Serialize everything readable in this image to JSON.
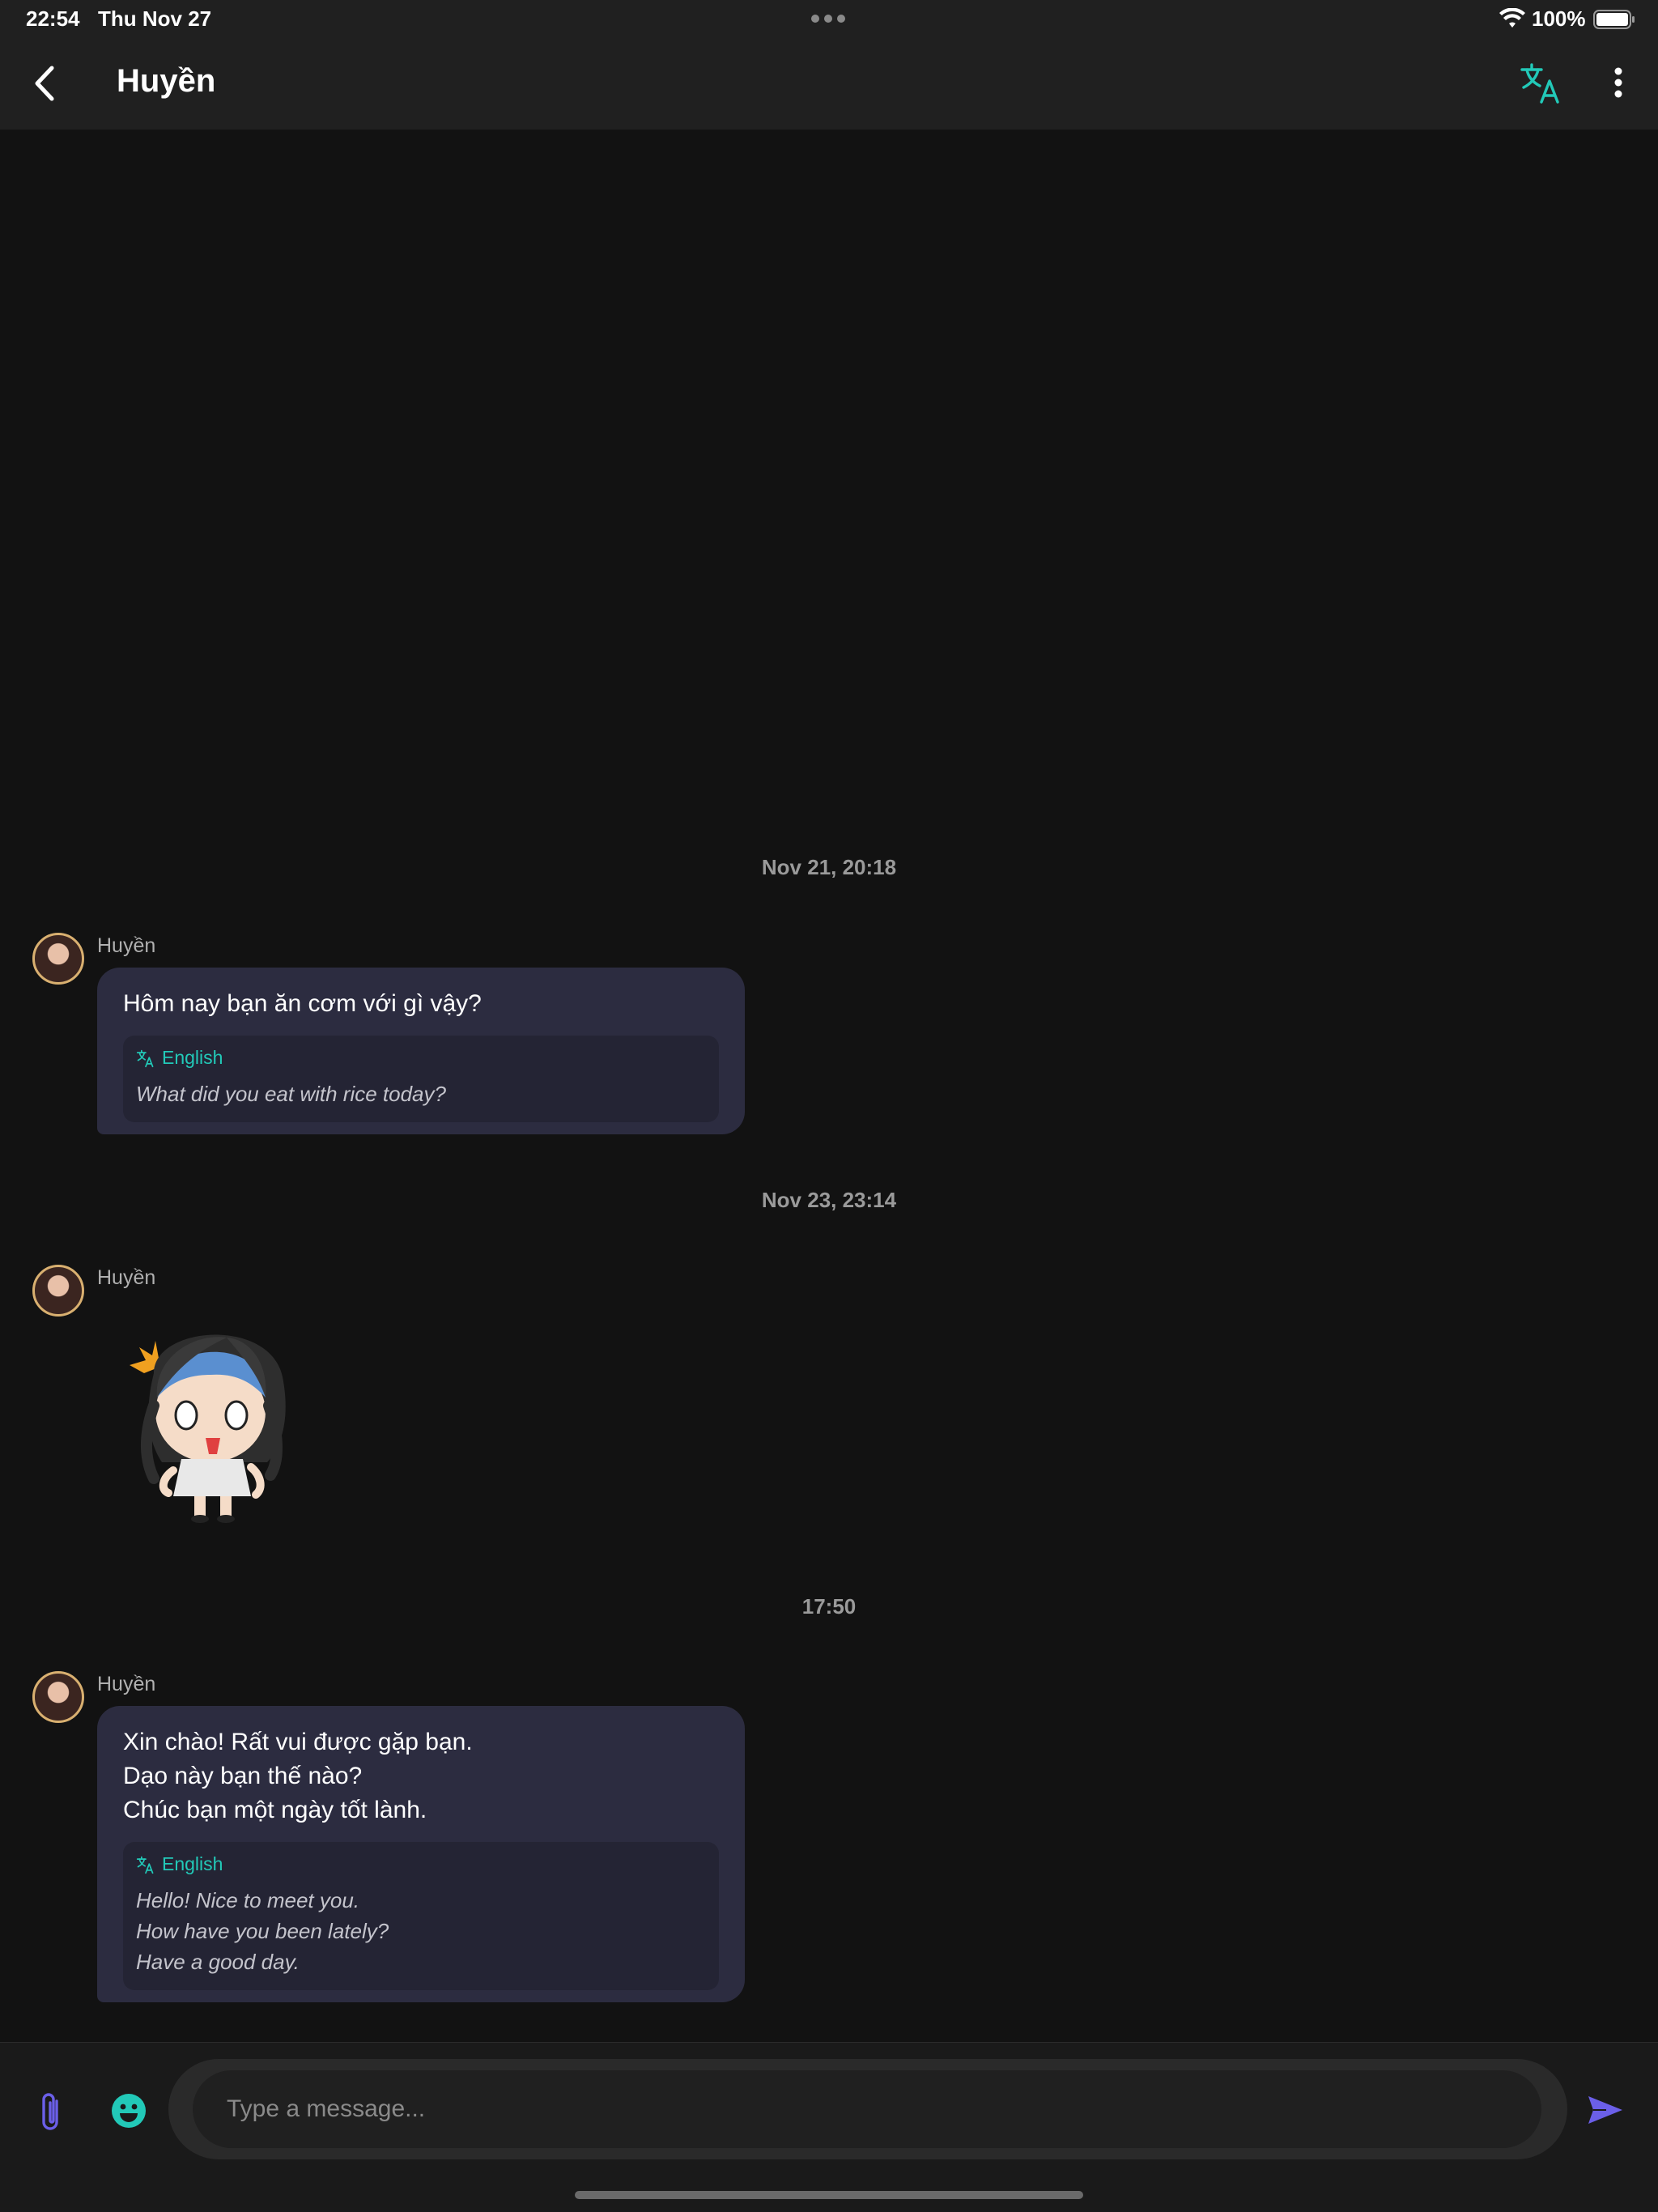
{
  "status_bar": {
    "time": "22:54",
    "date": "Thu Nov 27",
    "battery_percent": "100%",
    "battery_level": 1.0
  },
  "header": {
    "title": "Huyền",
    "accent_color": "#22c9b8"
  },
  "messages": [
    {
      "timestamp": "Nov 21, 20:18",
      "sender": "Huyền",
      "type": "text",
      "text": "Hôm nay bạn ăn cơm với gì vậy?",
      "translation_label": "English",
      "translation": "What did you eat with rice today?"
    },
    {
      "timestamp": "Nov 23, 23:14",
      "sender": "Huyền",
      "type": "sticker",
      "sticker_icon": "surprised-chibi-girl-sticker"
    },
    {
      "timestamp": "17:50",
      "sender": "Huyền",
      "type": "text",
      "text": "Xin chào! Rất vui được gặp bạn.\nDạo này bạn thế nào?\nChúc bạn một ngày tốt lành.",
      "translation_label": "English",
      "translation": "Hello! Nice to meet you.\nHow have you been lately?\nHave a good day."
    }
  ],
  "composer": {
    "placeholder": "Type a message...",
    "value": "",
    "send_color": "#6b5fe8"
  }
}
